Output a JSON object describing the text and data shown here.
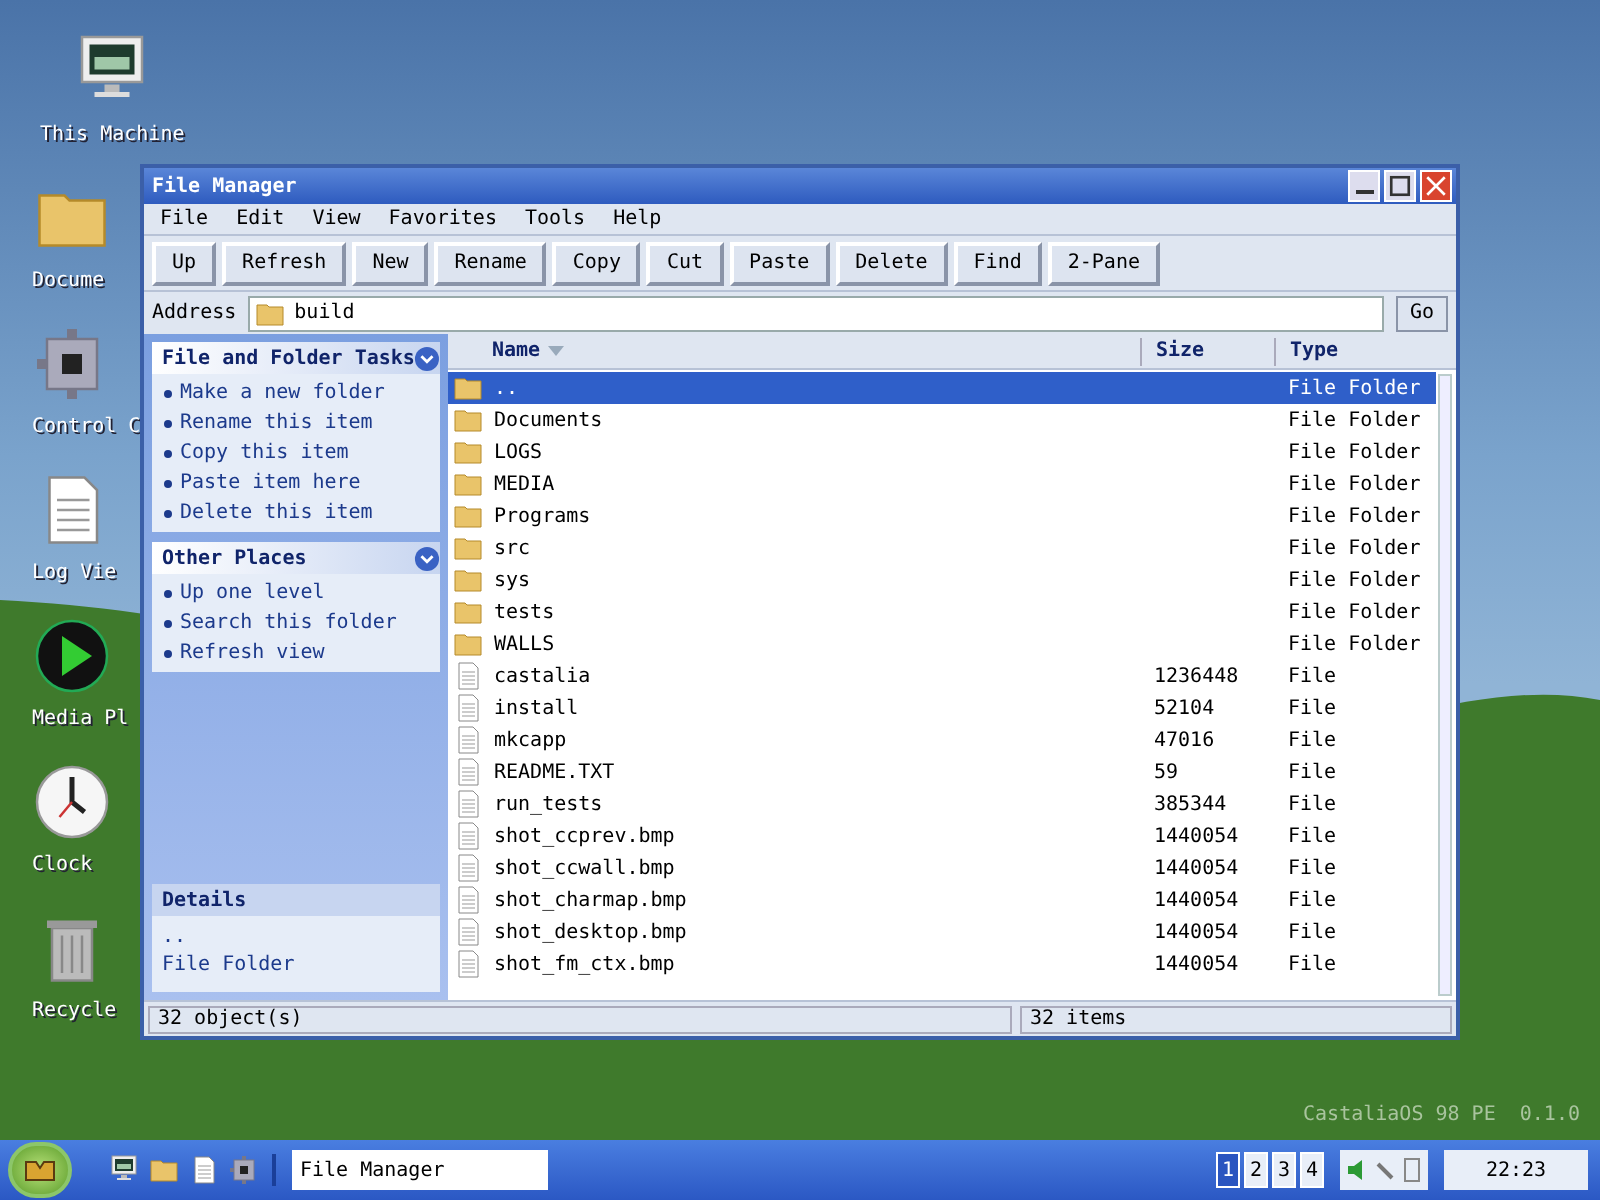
{
  "desktop_icons": [
    {
      "kind": "monitor",
      "label": "This Machine"
    },
    {
      "kind": "folder",
      "label": "Docume"
    },
    {
      "kind": "gear",
      "label": "Control C"
    },
    {
      "kind": "document",
      "label": "Log Vie"
    },
    {
      "kind": "play",
      "label": "Media Pl"
    },
    {
      "kind": "clock",
      "label": "Clock"
    },
    {
      "kind": "trash",
      "label": "Recycle"
    }
  ],
  "window": {
    "title": "File Manager",
    "menu": [
      "File",
      "Edit",
      "View",
      "Favorites",
      "Tools",
      "Help"
    ],
    "toolbar": [
      "Up",
      "Refresh",
      "New",
      "Rename",
      "Copy",
      "Cut",
      "Paste",
      "Delete",
      "Find",
      "2-Pane"
    ],
    "address": {
      "label": "Address",
      "value": "build",
      "go": "Go"
    },
    "sidebar": [
      {
        "title": "File and Folder Tasks",
        "items": [
          "Make a new folder",
          "Rename this item",
          "Copy this item",
          "Paste item here",
          "Delete this item"
        ]
      },
      {
        "title": "Other Places",
        "items": [
          "Up one level",
          "Search this folder",
          "Refresh view"
        ]
      }
    ],
    "details": {
      "title": "Details",
      "lines": [
        "..",
        "File Folder"
      ]
    },
    "table": {
      "columns": [
        "Name",
        "Size",
        "Type"
      ],
      "rows": [
        {
          "kind": "folder",
          "name": "..",
          "type": "File Folder",
          "selected": true
        },
        {
          "kind": "folder",
          "name": "Documents",
          "type": "File Folder",
          "selected": false
        },
        {
          "kind": "folder",
          "name": "LOGS",
          "type": "File Folder",
          "selected": false
        },
        {
          "kind": "folder",
          "name": "MEDIA",
          "type": "File Folder",
          "selected": false
        },
        {
          "kind": "folder",
          "name": "Programs",
          "type": "File Folder",
          "selected": false
        },
        {
          "kind": "folder",
          "name": "src",
          "type": "File Folder",
          "selected": false
        },
        {
          "kind": "folder",
          "name": "sys",
          "type": "File Folder",
          "selected": false
        },
        {
          "kind": "folder",
          "name": "tests",
          "type": "File Folder",
          "selected": false
        },
        {
          "kind": "folder",
          "name": "WALLS",
          "type": "File Folder",
          "selected": false
        },
        {
          "kind": "file",
          "name": "castalia",
          "size": "1236448",
          "type": "File",
          "selected": false
        },
        {
          "kind": "file",
          "name": "install",
          "size": "52104",
          "type": "File",
          "selected": false
        },
        {
          "kind": "file",
          "name": "mkcapp",
          "size": "47016",
          "type": "File",
          "selected": false
        },
        {
          "kind": "file",
          "name": "README.TXT",
          "size": "59",
          "type": "File",
          "selected": false
        },
        {
          "kind": "file",
          "name": "run_tests",
          "size": "385344",
          "type": "File",
          "selected": false
        },
        {
          "kind": "file",
          "name": "shot_ccprev.bmp",
          "size": "1440054",
          "type": "File",
          "selected": false
        },
        {
          "kind": "file",
          "name": "shot_ccwall.bmp",
          "size": "1440054",
          "type": "File",
          "selected": false
        },
        {
          "kind": "file",
          "name": "shot_charmap.bmp",
          "size": "1440054",
          "type": "File",
          "selected": false
        },
        {
          "kind": "file",
          "name": "shot_desktop.bmp",
          "size": "1440054",
          "type": "File",
          "selected": false
        },
        {
          "kind": "file",
          "name": "shot_fm_ctx.bmp",
          "size": "1440054",
          "type": "File",
          "selected": false
        }
      ]
    },
    "status_bar": [
      "32 object(s)",
      "32 items"
    ]
  },
  "watermark": "CastaliaOS 98 PE  0.1.0",
  "taskbar": {
    "quick_launch": [
      {
        "kind": "monitor"
      },
      {
        "kind": "folder"
      },
      {
        "kind": "document"
      },
      {
        "kind": "gear"
      }
    ],
    "task": "File Manager",
    "workspaces": [
      {
        "label": "1",
        "selected": true
      },
      {
        "label": "2",
        "selected": false
      },
      {
        "label": "3",
        "selected": false
      },
      {
        "label": "4",
        "selected": false
      }
    ],
    "clock": "22:23"
  }
}
